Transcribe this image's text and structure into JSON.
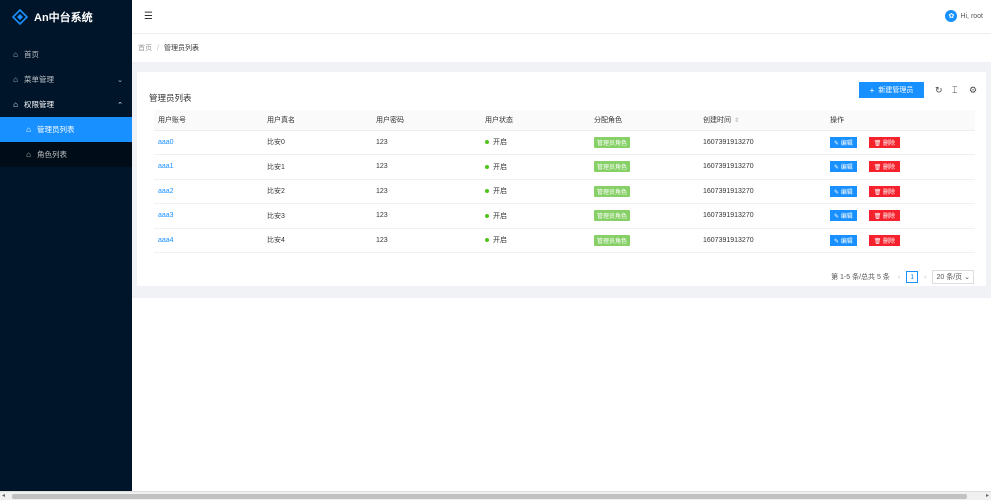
{
  "app": {
    "title": "An中台系统"
  },
  "sidebar": {
    "items": [
      {
        "label": "首页"
      },
      {
        "label": "菜单管理"
      },
      {
        "label": "权限管理"
      }
    ],
    "sub": [
      {
        "label": "管理员列表"
      },
      {
        "label": "角色列表"
      }
    ]
  },
  "header": {
    "user": "Hi, root"
  },
  "breadcrumb": {
    "home": "首页",
    "current": "管理员列表"
  },
  "card": {
    "title": "管理员列表",
    "add_label": "新建管理员"
  },
  "table": {
    "columns": [
      "用户账号",
      "用户真名",
      "用户密码",
      "用户状态",
      "分配角色",
      "创建时间",
      "操作"
    ],
    "rows": [
      {
        "account": "aaa0",
        "name": "比安0",
        "password": "123",
        "status": "开启",
        "role": "管理员角色",
        "created": "1607391913270"
      },
      {
        "account": "aaa1",
        "name": "比安1",
        "password": "123",
        "status": "开启",
        "role": "管理员角色",
        "created": "1607391913270"
      },
      {
        "account": "aaa2",
        "name": "比安2",
        "password": "123",
        "status": "开启",
        "role": "管理员角色",
        "created": "1607391913270"
      },
      {
        "account": "aaa3",
        "name": "比安3",
        "password": "123",
        "status": "开启",
        "role": "管理员角色",
        "created": "1607391913270"
      },
      {
        "account": "aaa4",
        "name": "比安4",
        "password": "123",
        "status": "开启",
        "role": "管理员角色",
        "created": "1607391913270"
      }
    ],
    "edit_label": "编辑",
    "delete_label": "删除"
  },
  "pagination": {
    "summary": "第 1-5 条/总共 5 条",
    "page": "1",
    "page_size": "20 条/页"
  },
  "colors": {
    "accent": "#1890ff",
    "sidebar": "#001529",
    "success": "#87d068",
    "danger": "#f5222d"
  }
}
